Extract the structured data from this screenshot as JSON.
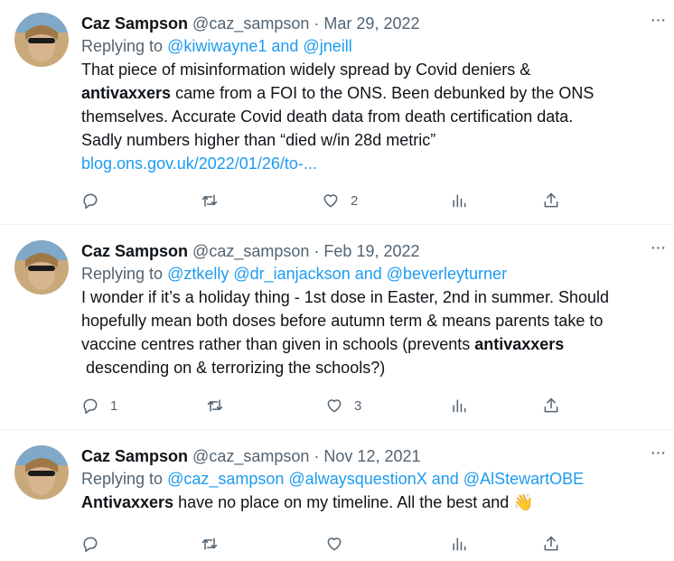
{
  "tweets": [
    {
      "name": "Caz Sampson",
      "handle": "@caz_sampson",
      "sep": "·",
      "date": "Mar 29, 2022",
      "replying_label": "Replying to",
      "replying_to": "@kiwiwayne1 and @jneill",
      "text_lines": [
        "That piece of misinformation widely spread by Covid deniers &",
        "came from a FOI to the ONS. Been debunked by the ONS",
        "themselves. Accurate Covid death data from death certification data.",
        "Sadly numbers higher than “died w/in 28d metric”"
      ],
      "bold_word": "antivaxxers",
      "link": "blog.ons.gov.uk/2022/01/26/to-...",
      "reply_count": "",
      "retweet_count": "",
      "like_count": "2"
    },
    {
      "name": "Caz Sampson",
      "handle": "@caz_sampson",
      "sep": "·",
      "date": "Feb 19, 2022",
      "replying_label": "Replying to",
      "replying_to": "@ztkelly @dr_ianjackson and @beverleyturner",
      "text_lines": [
        "I wonder if it’s a holiday thing - 1st dose in Easter, 2nd in summer. Should",
        "hopefully mean both doses before autumn term & means parents take to",
        "vaccine centres rather than given in schools (prevents",
        "descending on & terrorizing the schools?)"
      ],
      "bold_word": "antivaxxers",
      "reply_count": "1",
      "retweet_count": "",
      "like_count": "3"
    },
    {
      "name": "Caz Sampson",
      "handle": "@caz_sampson",
      "sep": "·",
      "date": "Nov 12, 2021",
      "replying_label": "Replying to",
      "replying_to": "@caz_sampson @alwaysquestionX and @AlStewartOBE",
      "bold_word": "Antivaxxers",
      "text_rest": "have no place on my timeline. All the best and",
      "emoji": "👋",
      "reply_count": "",
      "retweet_count": "",
      "like_count": ""
    }
  ],
  "more_label": "···"
}
